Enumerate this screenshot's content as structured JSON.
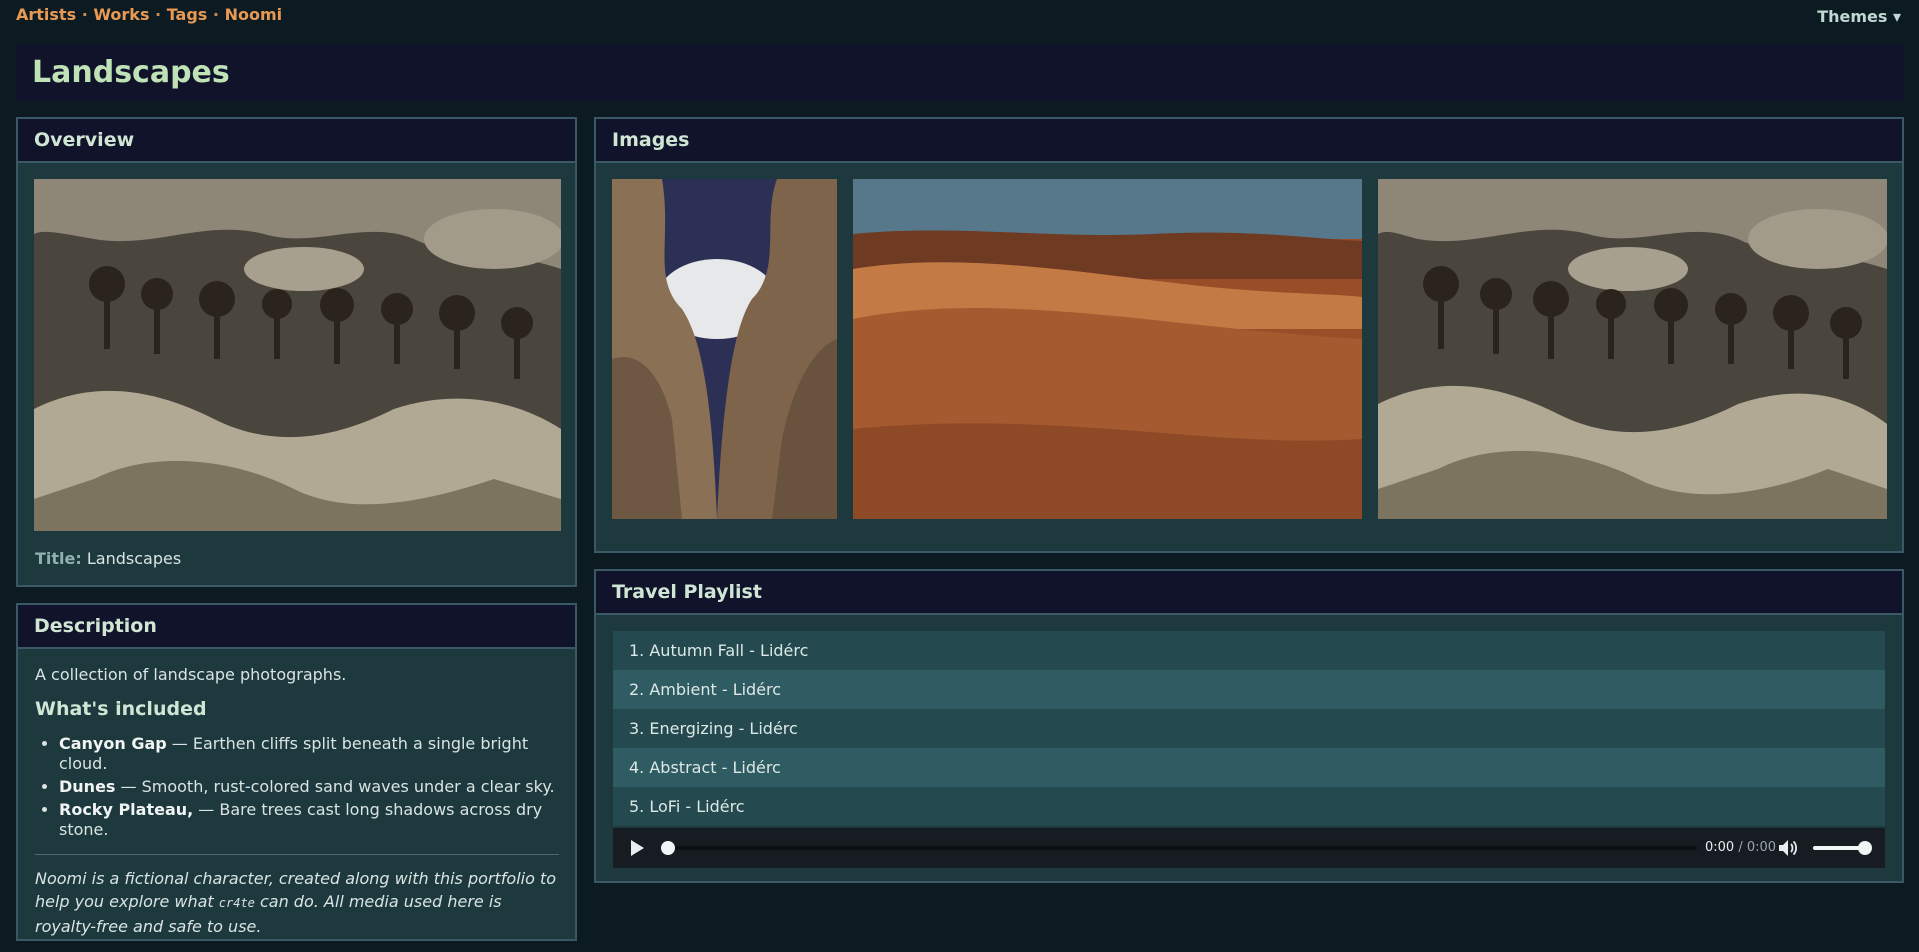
{
  "nav": {
    "links": [
      "Artists",
      "Works",
      "Tags",
      "Noomi"
    ],
    "separator": "·",
    "themes_label": "Themes ▾"
  },
  "page": {
    "title": "Landscapes"
  },
  "overview": {
    "heading": "Overview",
    "title_label": "Title:",
    "title_value": "Landscapes",
    "image_icon": "rocky-plateau-photo"
  },
  "description": {
    "heading": "Description",
    "lead": "A collection of landscape photographs.",
    "subheading": "What's included",
    "items": [
      {
        "name": "Canyon Gap",
        "text": " — Earthen cliffs split beneath a single bright cloud."
      },
      {
        "name": "Dunes",
        "text": " — Smooth, rust-colored sand waves under a clear sky."
      },
      {
        "name": "Rocky Plateau,",
        "text": " — Bare trees cast long shadows across dry stone."
      }
    ],
    "note_before": "Noomi is a fictional character, created along with this portfolio to help you explore what ",
    "note_code": "cr4te",
    "note_after": " can do. All media used here is royalty-free and safe to use."
  },
  "images": {
    "heading": "Images",
    "items": [
      "canyon-gap-photo",
      "dunes-photo",
      "rocky-plateau-photo"
    ]
  },
  "playlist": {
    "heading": "Travel Playlist",
    "tracks": [
      "1. Autumn Fall - Lidérc",
      "2. Ambient - Lidérc",
      "3. Energizing - Lidérc",
      "4. Abstract - Lidérc",
      "5. LoFi - Lidérc"
    ],
    "player": {
      "current": "0:00",
      "sep": " / ",
      "duration": "0:00",
      "progress": 0,
      "volume": 1
    }
  },
  "colors": {
    "accent": "#e89a55",
    "heading": "#bfe2b6",
    "panel": "#1d393e",
    "header": "#11132a"
  }
}
